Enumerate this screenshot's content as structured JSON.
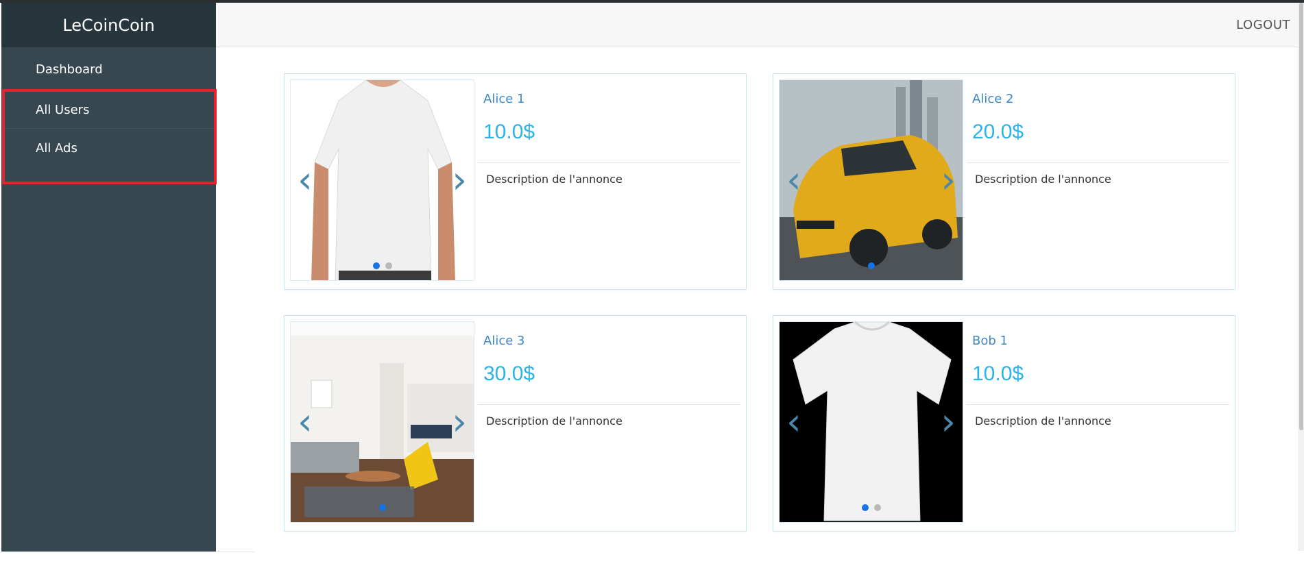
{
  "app": {
    "brand": "LeCoinCoin"
  },
  "header": {
    "logout_label": "LOGOUT"
  },
  "sidebar": {
    "items": [
      {
        "label": "Dashboard"
      },
      {
        "label": "All Users"
      },
      {
        "label": "All Ads"
      }
    ]
  },
  "ads": [
    {
      "title": "Alice 1",
      "price": "10.0$",
      "description": "Description de l'annonce",
      "image": "white-tshirt",
      "slides": 2,
      "active_slide": 1
    },
    {
      "title": "Alice 2",
      "price": "20.0$",
      "description": "Description de l'annonce",
      "image": "yellow-car",
      "slides": 1,
      "active_slide": 1
    },
    {
      "title": "Alice 3",
      "price": "30.0$",
      "description": "Description de l'annonce",
      "image": "living-room",
      "slides": 1,
      "active_slide": 1
    },
    {
      "title": "Bob 1",
      "price": "10.0$",
      "description": "Description de l'annonce",
      "image": "white-tshirt-black-bg",
      "slides": 2,
      "active_slide": 1
    }
  ],
  "carousel": {
    "prev_icon": "chevron-left-icon",
    "next_icon": "chevron-right-icon"
  },
  "colors": {
    "sidebar_bg": "#36474f",
    "brand_bg": "#27353c",
    "highlight_border": "#e8212c",
    "title_color": "#3f87c7",
    "price_color": "#2cb4e8",
    "dot_active": "#1573e6"
  }
}
